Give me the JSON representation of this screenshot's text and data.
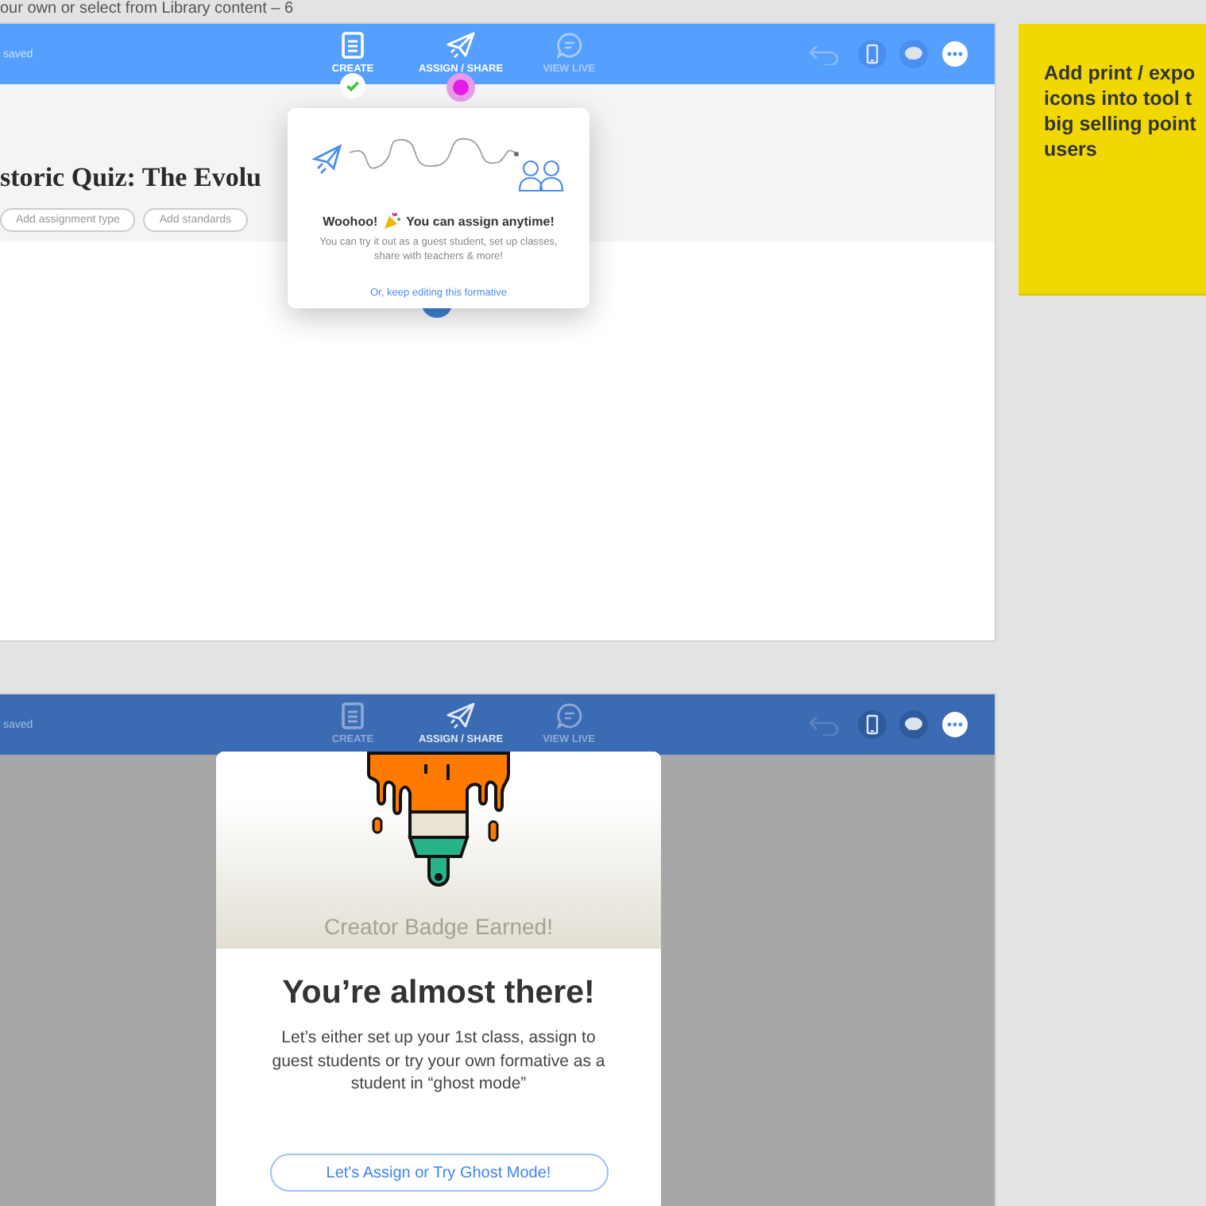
{
  "canvas_caption": "our own or select from Library content – 6",
  "frames": [
    {
      "kind": "editor",
      "status": "saved",
      "nav": [
        {
          "label": "CREATE",
          "dimmed": false,
          "completed": true,
          "active": false
        },
        {
          "label": "ASSIGN / SHARE",
          "dimmed": false,
          "completed": false,
          "active": true
        },
        {
          "label": "VIEW LIVE",
          "dimmed": true,
          "completed": false,
          "active": false
        }
      ],
      "title": "storic Quiz: The Evolu",
      "pills": [
        "Add assignment type",
        "Add standards"
      ],
      "popover": {
        "title_start": "Woohoo!",
        "title_end": "You can assign anytime!",
        "body": "You can try it out as a guest student, set up classes, share with teachers & more!",
        "link": "Or, keep editing this formative"
      }
    },
    {
      "kind": "modal",
      "status": "saved",
      "nav": [
        {
          "label": "CREATE",
          "dimmed": true,
          "completed": false,
          "active": false
        },
        {
          "label": "ASSIGN / SHARE",
          "dimmed": false,
          "completed": false,
          "active": false
        },
        {
          "label": "VIEW LIVE",
          "dimmed": true,
          "completed": false,
          "active": false
        }
      ],
      "modal": {
        "badge": "Creator Badge Earned!",
        "heading": "You’re almost there!",
        "body": "Let’s either set up your 1st class, assign to guest students or try your own formative as a student in “ghost mode”",
        "button": "Let's Assign or Try Ghost Mode!"
      }
    }
  ],
  "sticky_note": {
    "lines": [
      "Add print / expo",
      "icons into tool t",
      "big selling point",
      "users"
    ]
  }
}
